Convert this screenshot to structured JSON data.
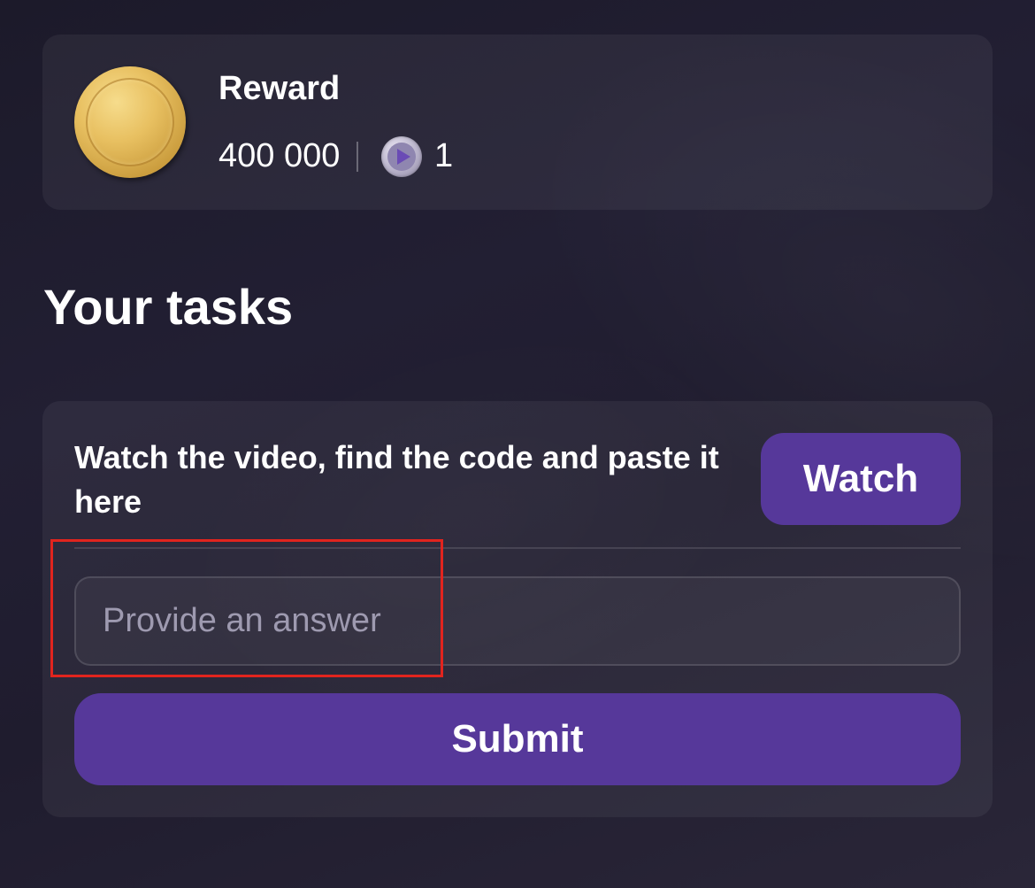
{
  "reward": {
    "title": "Reward",
    "amount": "400 000",
    "token_count": "1",
    "icons": {
      "coin": "gold-coin-icon",
      "token": "play-token-icon"
    }
  },
  "tasks": {
    "heading": "Your tasks",
    "items": [
      {
        "description": "Watch the video, find the code and paste it here",
        "watch_label": "Watch",
        "answer_placeholder": "Provide an answer",
        "answer_value": "",
        "submit_label": "Submit"
      }
    ]
  },
  "colors": {
    "accent": "#56389a",
    "highlight": "#e1241e",
    "coin_gold": "#e8c061"
  }
}
